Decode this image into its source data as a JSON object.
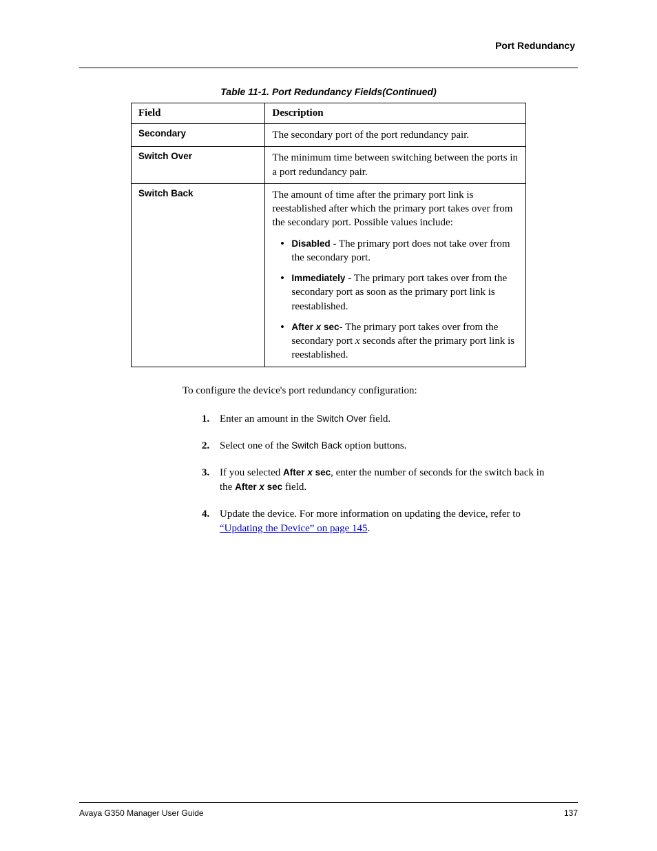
{
  "header": {
    "title": "Port Redundancy"
  },
  "table": {
    "caption": "Table 11-1.  Port Redundancy Fields(Continued)",
    "headers": {
      "field": "Field",
      "description": "Description"
    },
    "rows": [
      {
        "field": "Secondary",
        "desc": "The secondary port of the port redundancy pair."
      },
      {
        "field": "Switch Over",
        "desc": "The minimum time between switching between the ports in a port redundancy pair."
      },
      {
        "field": "Switch Back",
        "desc_intro": "The amount of time after the primary port link is reestablished after which the primary port takes over from the secondary port. Possible values include:",
        "bullets": [
          {
            "label": "Disabled",
            "dash": " - ",
            "text": "The primary port does not take over from the secondary port."
          },
          {
            "label": "Immediately",
            "dash": " - ",
            "text": "The primary port takes over from the secondary port as soon as the primary port link is reestablished."
          },
          {
            "label_pre": "After ",
            "label_ital": "x",
            "label_post": " sec",
            "dash": "- ",
            "text_pre": "The primary port takes over from the secondary port ",
            "text_ital": "x",
            "text_post": " seconds after the primary port link is reestablished."
          }
        ]
      }
    ]
  },
  "intro": "To configure the device's port redundancy configuration:",
  "steps": [
    {
      "num": "1.",
      "pre": "Enter an amount in the ",
      "term": "Switch Over",
      "post": " field."
    },
    {
      "num": "2.",
      "pre": "Select one of the ",
      "term": "Switch Back",
      "post": " option buttons."
    },
    {
      "num": "3.",
      "pre": "If you selected ",
      "bold_pre": "After ",
      "bold_ital": "x",
      "bold_post": " sec",
      "mid": ", enter the number of seconds for the switch back in the ",
      "bold2_pre": "After ",
      "bold2_ital": "x",
      "bold2_post": " sec",
      "post": " field."
    },
    {
      "num": "4.",
      "pre": "Update the device. For more information on updating the device, refer to ",
      "link": "“Updating the Device” on page 145",
      "post": "."
    }
  ],
  "footer": {
    "left": "Avaya G350 Manager User Guide",
    "right": "137"
  }
}
